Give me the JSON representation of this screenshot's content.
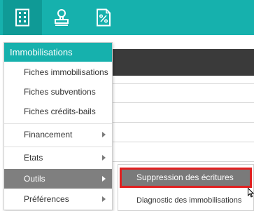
{
  "colors": {
    "accent": "#16b1ad",
    "active_item": "#7f7f7f",
    "highlight_border": "#e02020"
  },
  "toolbar": {
    "buttons": [
      {
        "icon": "building-icon",
        "active": true
      },
      {
        "icon": "stamp-icon",
        "active": false
      },
      {
        "icon": "percent-document-icon",
        "active": false
      }
    ]
  },
  "menu": {
    "header": "Immobilisations",
    "items": [
      {
        "label": "Fiches immobilisations"
      },
      {
        "label": "Fiches subventions"
      },
      {
        "label": "Fiches crédits-bails"
      },
      {
        "label": "Financement",
        "has_submenu": true
      },
      {
        "label": "Etats",
        "has_submenu": true
      },
      {
        "label": "Outils",
        "has_submenu": true,
        "active": true
      },
      {
        "label": "Préférences",
        "has_submenu": true
      }
    ]
  },
  "submenu": {
    "items": [
      {
        "label": "Suppression des écritures",
        "highlighted": true
      },
      {
        "label": "Diagnostic des immobilisations"
      }
    ]
  }
}
